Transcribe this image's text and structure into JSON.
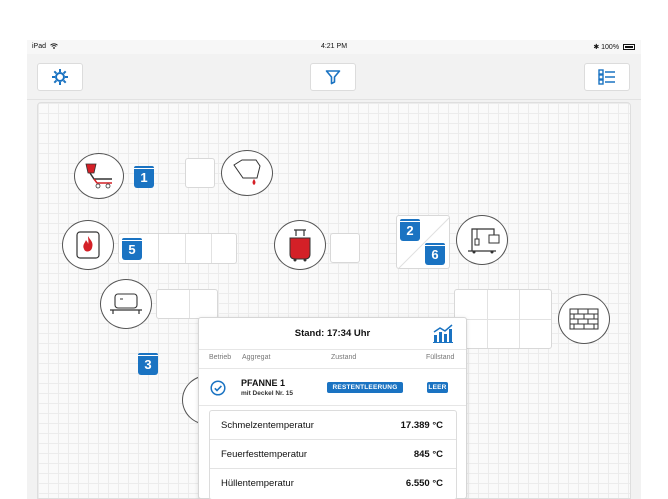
{
  "status_bar": {
    "device": "iPad",
    "wifi_icon": "wifi-icon",
    "time": "4:21 PM",
    "battery": "100%",
    "bluetooth_icon": "bluetooth-icon"
  },
  "toolbar": {
    "settings_icon": "gear-icon",
    "filter_icon": "filter-icon",
    "list_icon": "list-icon"
  },
  "colors": {
    "accent": "#1a73c2",
    "alert_red": "#d42027"
  },
  "units": [
    {
      "number": "1",
      "icon": "ladle-pour-icon"
    },
    {
      "number": "5",
      "icon": "fire-ladle-icon"
    },
    {
      "number": "2",
      "icon": "ladle-icon"
    },
    {
      "number": "6",
      "icon": "ladle-icon"
    },
    {
      "number": "3",
      "icon": "ladle-icon"
    }
  ],
  "station_icons": [
    "ladle-pour-icon",
    "drip-icon",
    "fire-ladle-icon",
    "red-ladle-icon",
    "crane-icon",
    "tank-car-icon",
    "bricks-icon"
  ],
  "detail": {
    "title": "Stand: 17:34 Uhr",
    "chart_icon": "chart-icon",
    "columns": {
      "operation": "Betrieb",
      "unit": "Aggregat",
      "state": "Zustand",
      "fill": "Füllstand"
    },
    "unit_name": "PFANNE 1",
    "unit_sub": "mit Deckel Nr. 15",
    "state": "RESTENTLEERUNG",
    "fill": "LEER",
    "check_icon": "check-circle-icon",
    "temperatures": [
      {
        "label": "Schmelzentemperatur",
        "value": "17.389 °C"
      },
      {
        "label": "Feuerfesttemperatur",
        "value": "845 °C"
      },
      {
        "label": "Hüllentemperatur",
        "value": "6.550 °C"
      }
    ]
  }
}
